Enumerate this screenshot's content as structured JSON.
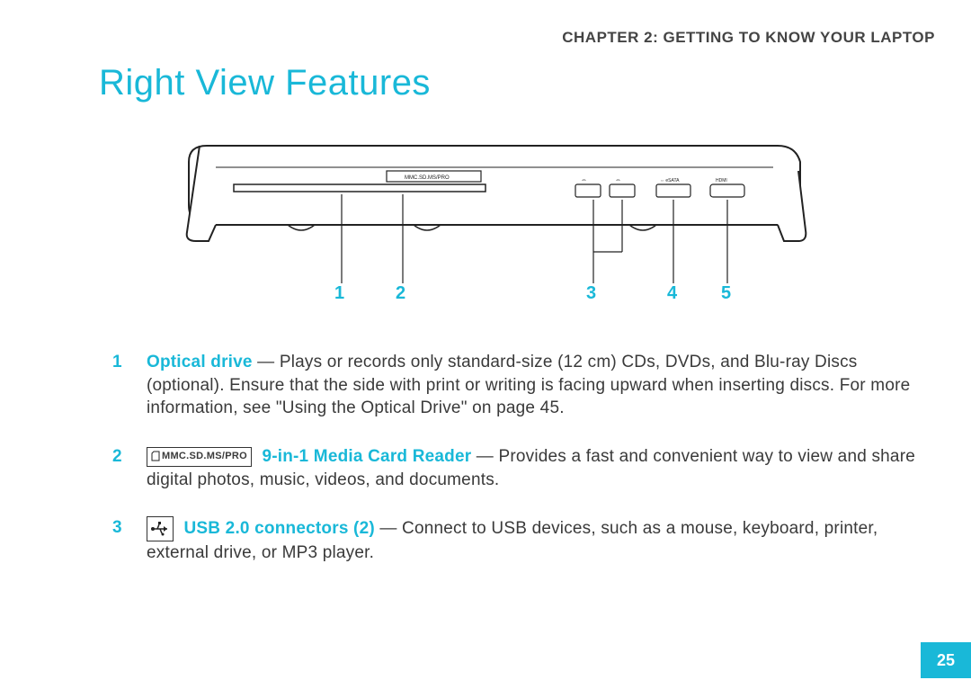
{
  "header": "CHAPTER 2: GETTING TO KNOW YOUR LAPTOP",
  "title": "Right View Features",
  "callouts": [
    "1",
    "2",
    "3",
    "4",
    "5"
  ],
  "icons": {
    "mmc_label": "MMC.SD.MS/PRO",
    "usb_label": "USB"
  },
  "features": [
    {
      "num": "1",
      "name": "Optical drive",
      "desc": " — Plays or records only standard-size (12 cm) CDs, DVDs, and Blu-ray Discs (optional). Ensure that the side with print or writing is facing upward when inserting discs. For more information, see \"Using the Optical Drive\" on page 45."
    },
    {
      "num": "2",
      "icon": "mmc",
      "name": "9-in-1 Media Card Reader",
      "desc": " — Provides a fast and convenient way to view and share digital photos, music, videos, and documents."
    },
    {
      "num": "3",
      "icon": "usb",
      "name": "USB 2.0 connectors (2)",
      "desc": " — Connect to USB devices, such as a mouse, keyboard, printer, external drive, or MP3 player."
    }
  ],
  "page_number": "25",
  "colors": {
    "accent": "#19b8d8"
  }
}
